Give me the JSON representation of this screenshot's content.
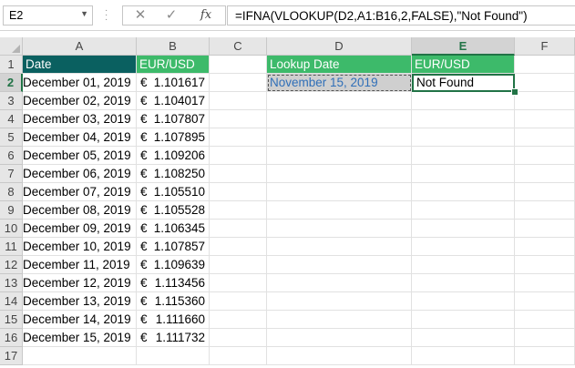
{
  "name_box": {
    "value": "E2"
  },
  "formula_bar": {
    "cancel_glyph": "✕",
    "enter_glyph": "✓",
    "fx_label": "fx",
    "formula": "=IFNA(VLOOKUP(D2,A1:B16,2,FALSE),\"Not Found\")"
  },
  "columns": [
    "A",
    "B",
    "C",
    "D",
    "E",
    "F"
  ],
  "active_column": "E",
  "rows": [
    "1",
    "2",
    "3",
    "4",
    "5",
    "6",
    "7",
    "8",
    "9",
    "10",
    "11",
    "12",
    "13",
    "14",
    "15",
    "16",
    "17"
  ],
  "active_row": "2",
  "headers": {
    "a1": "Date",
    "b1": "EUR/USD",
    "d1": "Lookup Date",
    "e1": "EUR/USD"
  },
  "currency_symbol": "€",
  "data": [
    {
      "date": "December 01, 2019",
      "rate": "1.101617"
    },
    {
      "date": "December 02, 2019",
      "rate": "1.104017"
    },
    {
      "date": "December 03, 2019",
      "rate": "1.107807"
    },
    {
      "date": "December 04, 2019",
      "rate": "1.107895"
    },
    {
      "date": "December 05, 2019",
      "rate": "1.109206"
    },
    {
      "date": "December 06, 2019",
      "rate": "1.108250"
    },
    {
      "date": "December 07, 2019",
      "rate": "1.105510"
    },
    {
      "date": "December 08, 2019",
      "rate": "1.105528"
    },
    {
      "date": "December 09, 2019",
      "rate": "1.106345"
    },
    {
      "date": "December 10, 2019",
      "rate": "1.107857"
    },
    {
      "date": "December 11, 2019",
      "rate": "1.109639"
    },
    {
      "date": "December 12, 2019",
      "rate": "1.113456"
    },
    {
      "date": "December 13, 2019",
      "rate": "1.115360"
    },
    {
      "date": "December 14, 2019",
      "rate": "1.111660"
    },
    {
      "date": "December 15, 2019",
      "rate": "1.111732"
    }
  ],
  "lookup": {
    "d2": "November 15, 2019",
    "e2": "Not Found"
  },
  "colors": {
    "header_dark": "#0a6060",
    "header_green": "#3dba6a",
    "selection": "#217346",
    "lookup_text": "#2f6fb8"
  }
}
